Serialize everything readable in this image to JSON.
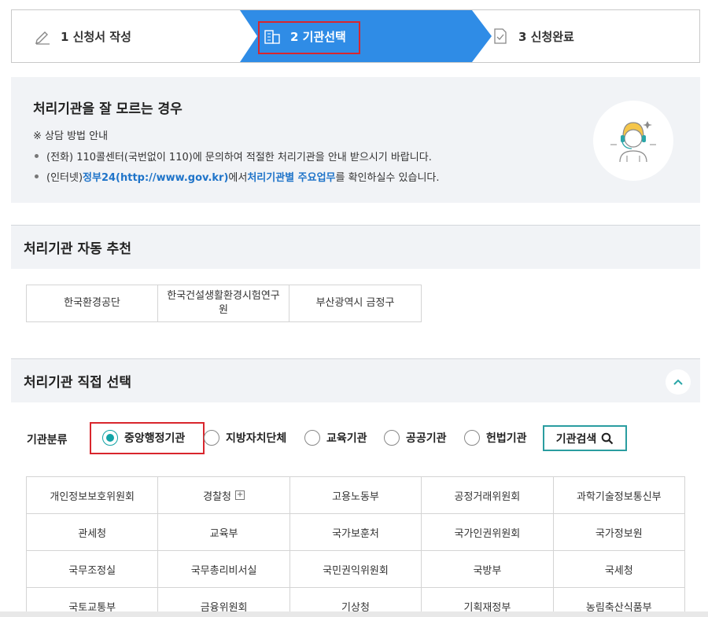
{
  "colors": {
    "accent": "#2f8ce6",
    "teal": "#12a3a6",
    "highlight": "#d9262d"
  },
  "steps": [
    {
      "label": "1 신청서 작성",
      "icon": "pencil-icon"
    },
    {
      "label": "2 기관선택",
      "icon": "building-icon"
    },
    {
      "label": "3 신청완료",
      "icon": "document-check-icon"
    }
  ],
  "info": {
    "title": "처리기관을 잘 모르는 경우",
    "subtitle": "※ 상담 방법 안내",
    "line1": "(전화) 110콜센터(국번없이 110)에 문의하여 적절한 처리기관을 안내 받으시기 바랍니다.",
    "line2_prefix": "(인터넷) ",
    "line2_link1": "정부24(http://www.gov.kr)",
    "line2_mid": "에서 ",
    "line2_link2": "처리기관별 주요업무",
    "line2_suffix": "를 확인하실수 있습니다.",
    "avatar_icon": "consultant-headset-icon"
  },
  "auto": {
    "title": "처리기관 자동 추천",
    "items": [
      "한국환경공단",
      "한국건설생활환경시험연구원",
      "부산광역시 금정구"
    ]
  },
  "direct": {
    "title": "처리기관 직접 선택",
    "category_label": "기관분류",
    "options": [
      "중앙행정기관",
      "지방자치단체",
      "교육기관",
      "공공기관",
      "헌법기관"
    ],
    "selected": "중앙행정기관",
    "search_label": "기관검색"
  },
  "agencies": [
    "개인정보보호위원회",
    "경찰청",
    "고용노동부",
    "공정거래위원회",
    "과학기술정보통신부",
    "관세청",
    "교육부",
    "국가보훈처",
    "국가인권위원회",
    "국가정보원",
    "국무조정실",
    "국무총리비서실",
    "국민권익위원회",
    "국방부",
    "국세청",
    "국토교통부",
    "금융위원회",
    "기상청",
    "기획재정부",
    "농림축산식품부"
  ]
}
